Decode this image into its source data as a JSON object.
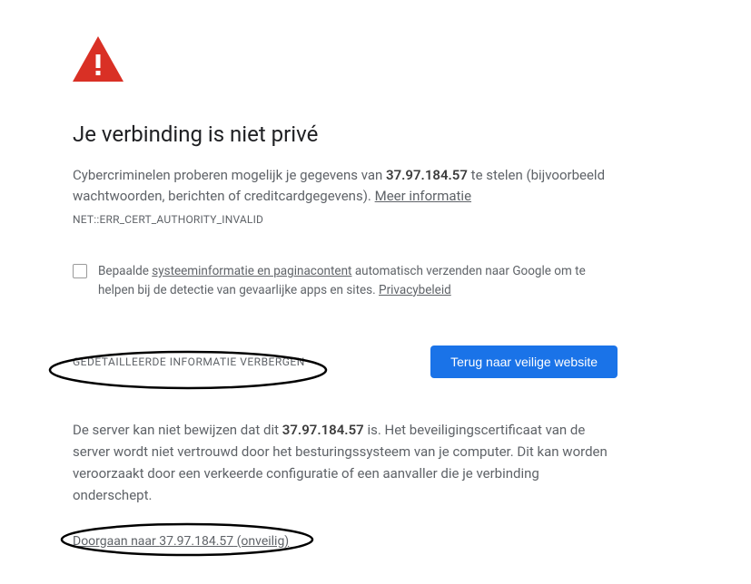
{
  "warning": {
    "title": "Je verbinding is niet privé",
    "desc_before": "Cybercriminelen proberen mogelijk je gegevens van ",
    "host": "37.97.184.57",
    "desc_after": " te stelen (bijvoorbeeld wachtwoorden, berichten of creditcardgegevens). ",
    "learn_more": "Meer informatie",
    "error_code": "NET::ERR_CERT_AUTHORITY_INVALID"
  },
  "checkbox": {
    "label_before": "Bepaalde ",
    "system_info_link": "systeeminformatie en paginacontent",
    "label_mid": " automatisch verzenden naar Google om te helpen bij de detectie van gevaarlijke apps en sites. ",
    "privacy_link": "Privacybeleid"
  },
  "buttons": {
    "hide_details": "GEDETAILLEERDE INFORMATIE VERBERGEN",
    "back_to_safety": "Terug naar veilige website"
  },
  "details": {
    "text_before": "De server kan niet bewijzen dat dit ",
    "host": "37.97.184.57",
    "text_after": " is. Het beveiligingscertificaat van de server wordt niet vertrouwd door het besturingssysteem van je computer. Dit kan worden veroorzaakt door een verkeerde configuratie of een aanvaller die je verbinding onderschept.",
    "proceed_before": "Doorgaan naar ",
    "proceed_host": "37.97.184.57",
    "proceed_after": " (onveilig)"
  }
}
